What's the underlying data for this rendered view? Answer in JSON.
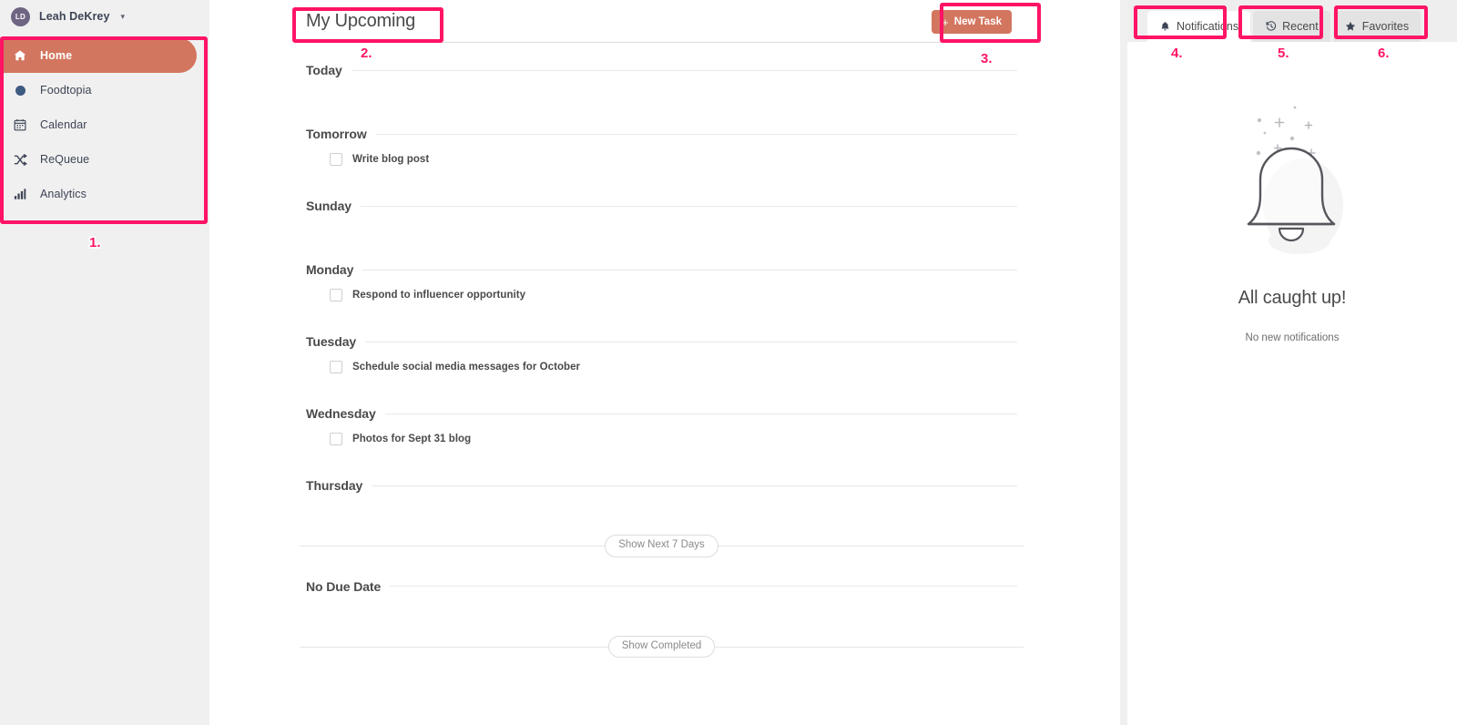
{
  "sidebar": {
    "user": {
      "initials": "LD",
      "name": "Leah DeKrey",
      "caret": "chevron-down"
    },
    "items": [
      {
        "label": "Home",
        "icon": "home-icon",
        "active": true
      },
      {
        "label": "Foodtopia",
        "icon": "dot-icon",
        "active": false
      },
      {
        "label": "Calendar",
        "icon": "calendar-icon",
        "active": false
      },
      {
        "label": "ReQueue",
        "icon": "shuffle-icon",
        "active": false
      },
      {
        "label": "Analytics",
        "icon": "bar-chart-icon",
        "active": false
      }
    ]
  },
  "main": {
    "title": "My Upcoming",
    "new_task_label": "New Task",
    "new_task_plus": "+",
    "groups": [
      {
        "label": "Today",
        "tasks": []
      },
      {
        "label": "Tomorrow",
        "tasks": [
          {
            "title": "Write blog post",
            "checked": false
          }
        ]
      },
      {
        "label": "Sunday",
        "tasks": []
      },
      {
        "label": "Monday",
        "tasks": [
          {
            "title": "Respond to influencer opportunity",
            "checked": false
          }
        ]
      },
      {
        "label": "Tuesday",
        "tasks": [
          {
            "title": "Schedule social media messages for October",
            "checked": false
          }
        ]
      },
      {
        "label": "Wednesday",
        "tasks": [
          {
            "title": "Photos for Sept 31 blog",
            "checked": false
          }
        ]
      },
      {
        "label": "Thursday",
        "tasks": []
      }
    ],
    "show_next_label": "Show Next 7 Days",
    "no_due_date_label": "No Due Date",
    "show_completed_label": "Show Completed"
  },
  "right_panel": {
    "tabs": [
      {
        "label": "Notifications",
        "icon": "bell-icon",
        "active": true
      },
      {
        "label": "Recent",
        "icon": "clock-icon",
        "active": false
      },
      {
        "label": "Favorites",
        "icon": "star-icon",
        "active": false
      }
    ],
    "empty": {
      "illustration": "bell-illustration",
      "title": "All caught up!",
      "subtitle": "No new notifications"
    }
  },
  "annotations": [
    {
      "number": "1."
    },
    {
      "number": "2."
    },
    {
      "number": "3."
    },
    {
      "number": "4."
    },
    {
      "number": "5."
    },
    {
      "number": "6."
    }
  ],
  "colors": {
    "accent": "#d3765f",
    "annotation": "#ff1466",
    "sidebar_bg": "#f0f0f0",
    "avatar_bg": "#6e6583",
    "dot": "#3d5a80"
  }
}
